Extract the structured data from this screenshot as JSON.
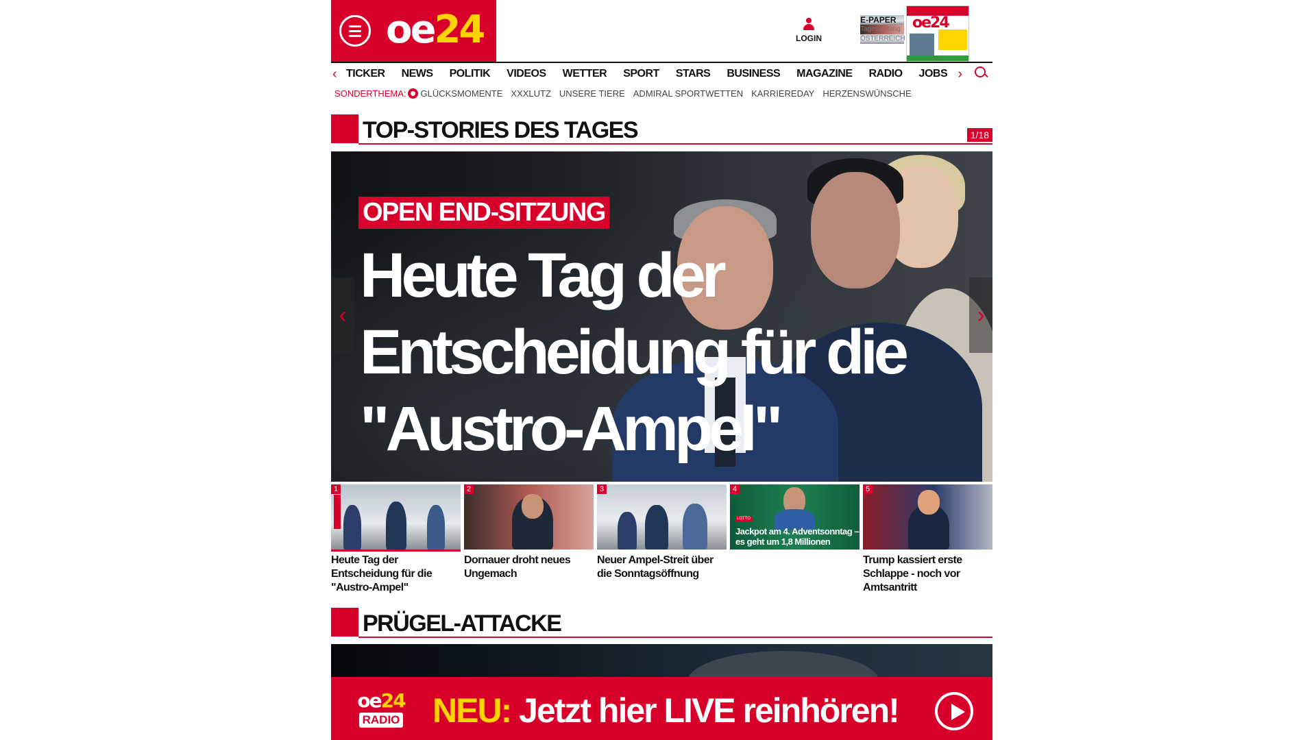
{
  "header": {
    "logo": {
      "main": "oe",
      "accent": "24"
    },
    "login_label": "LOGIN",
    "epaper": {
      "title": "E-PAPER",
      "sub1": "Tageszeitung",
      "sub2": "ÖSTERREICH"
    },
    "cover_logo": "oe24"
  },
  "nav": {
    "prev": "‹",
    "next": "›",
    "items": [
      "TICKER",
      "NEWS",
      "POLITIK",
      "VIDEOS",
      "WETTER",
      "SPORT",
      "STARS",
      "BUSINESS",
      "MAGAZINE",
      "RADIO",
      "JOBS"
    ]
  },
  "sonderthema": {
    "label": "SONDERTHEMA:",
    "items": [
      "GLÜCKSMOMENTE",
      "XXXLUTZ",
      "UNSERE TIERE",
      "ADMIRAL SPORTWETTEN",
      "KARRIEREDAY",
      "HERZENSWÜNSCHE"
    ]
  },
  "top_stories": {
    "title": "TOP-STORIES DES TAGES",
    "counter": "1/18",
    "hero": {
      "kicker": "OPEN END-SITZUNG",
      "headline": "Heute Tag der Entscheidung für die \"Austro-Ampel\"",
      "prev": "‹",
      "next": "›"
    },
    "thumbs": [
      {
        "num": "1",
        "caption": "Heute Tag der Entscheidung für die \"Austro-Ampel\"",
        "overlay": ""
      },
      {
        "num": "2",
        "caption": "Dornauer droht neues Ungemach",
        "overlay": ""
      },
      {
        "num": "3",
        "caption": "Neuer Ampel-Streit über die Sonntagsöffnung",
        "overlay": ""
      },
      {
        "num": "4",
        "caption": "",
        "overlay": "Jackpot am 4. Adventsonntag – es geht um 1,8 Millionen",
        "badge": "LOTTO"
      },
      {
        "num": "5",
        "caption": "Trump kassiert erste Schlappe - noch vor Amtsantritt",
        "overlay": ""
      }
    ]
  },
  "second_section": {
    "title": "PRÜGEL-ATTACKE"
  },
  "radio_banner": {
    "logo_main": "oe",
    "logo_accent": "24",
    "logo_sub": "RADIO",
    "neu": "NEU:",
    "text": " Jetzt hier LIVE reinhören!"
  },
  "colors": {
    "brand_red": "#d8002b",
    "accent_yellow": "#ffd400"
  }
}
